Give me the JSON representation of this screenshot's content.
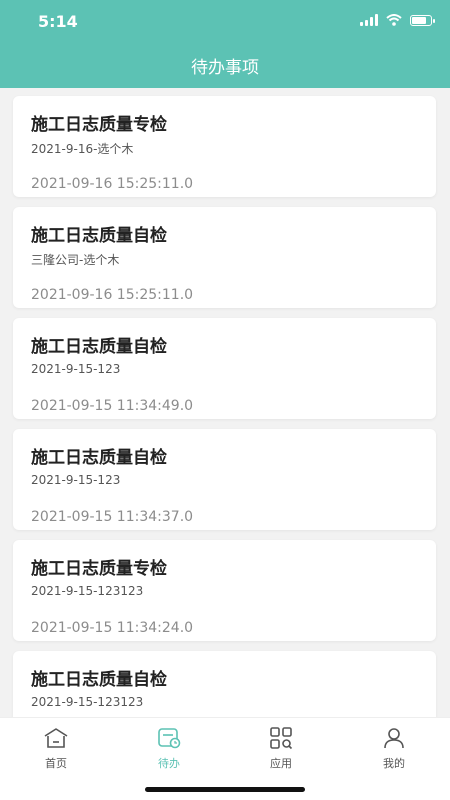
{
  "status_bar": {
    "time": "5:14"
  },
  "header": {
    "title": "待办事项"
  },
  "items": [
    {
      "title": "施工日志质量专检",
      "subtitle": "2021-9-16-选个木",
      "time": "2021-09-16 15:25:11.0"
    },
    {
      "title": "施工日志质量自检",
      "subtitle": "三隆公司-选个木",
      "time": "2021-09-16 15:25:11.0"
    },
    {
      "title": "施工日志质量自检",
      "subtitle": "2021-9-15-123",
      "time": "2021-09-15 11:34:49.0"
    },
    {
      "title": "施工日志质量自检",
      "subtitle": "2021-9-15-123",
      "time": "2021-09-15 11:34:37.0"
    },
    {
      "title": "施工日志质量专检",
      "subtitle": "2021-9-15-123123",
      "time": "2021-09-15 11:34:24.0"
    },
    {
      "title": "施工日志质量自检",
      "subtitle": "2021-9-15-123123",
      "time": ""
    }
  ],
  "tabbar": {
    "tabs": [
      {
        "label": "首页",
        "icon": "home-icon",
        "active": false
      },
      {
        "label": "待办",
        "icon": "todo-icon",
        "active": true
      },
      {
        "label": "应用",
        "icon": "apps-icon",
        "active": false
      },
      {
        "label": "我的",
        "icon": "profile-icon",
        "active": false
      }
    ]
  },
  "colors": {
    "accent": "#5cc2b4"
  }
}
